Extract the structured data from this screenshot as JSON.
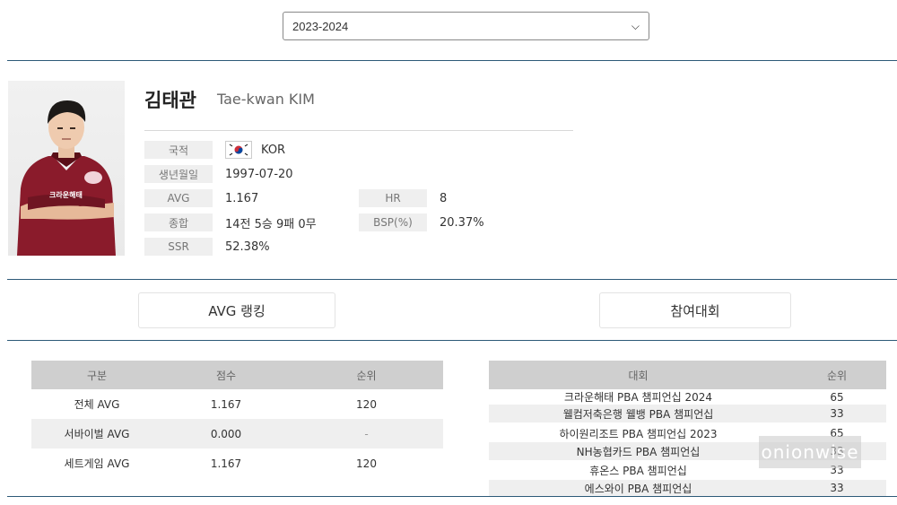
{
  "season_select": {
    "value": "2023-2024"
  },
  "player": {
    "name_ko": "김태관",
    "name_en": "Tae-kwan KIM",
    "jersey_text": "크라운해태"
  },
  "info": {
    "nationality_label": "국적",
    "nationality_value": "KOR",
    "birth_label": "생년월일",
    "birth_value": "1997-07-20",
    "avg_label": "AVG",
    "avg_value": "1.167",
    "hr_label": "HR",
    "hr_value": "8",
    "total_label": "종합",
    "total_value": "14전 5승 9패 0무",
    "bsp_label": "BSP(%)",
    "bsp_value": "20.37%",
    "ssr_label": "SSR",
    "ssr_value": "52.38%"
  },
  "buttons": {
    "avg_ranking": "AVG 랭킹",
    "tournaments": "참여대회"
  },
  "avg_table": {
    "headers": [
      "구분",
      "점수",
      "순위"
    ],
    "rows": [
      {
        "category": "전체 AVG",
        "score": "1.167",
        "rank": "120"
      },
      {
        "category": "서바이벌 AVG",
        "score": "0.000",
        "rank": "-"
      },
      {
        "category": "세트게임 AVG",
        "score": "1.167",
        "rank": "120"
      }
    ]
  },
  "tournament_table": {
    "headers": [
      "대회",
      "순위"
    ],
    "rows": [
      {
        "name": "크라운해태 PBA 챔피언십 2024",
        "rank": "65"
      },
      {
        "name": "웰컴저축은행 웰뱅 PBA 챔피언십",
        "rank": "33"
      },
      {
        "name": "하이원리조트 PBA 챔피언십 2023",
        "rank": "65"
      },
      {
        "name": "NH농협카드 PBA 챔피언십",
        "rank": "33"
      },
      {
        "name": "휴온스 PBA 챔피언십",
        "rank": "33"
      },
      {
        "name": "에스와이 PBA 챔피언십",
        "rank": "33"
      }
    ]
  },
  "watermark": "onionwise",
  "colors": {
    "divider": "#2d5a78",
    "table_header": "#cfcfcf",
    "row_alt": "#efefef",
    "jersey": "#8a1b2b"
  }
}
